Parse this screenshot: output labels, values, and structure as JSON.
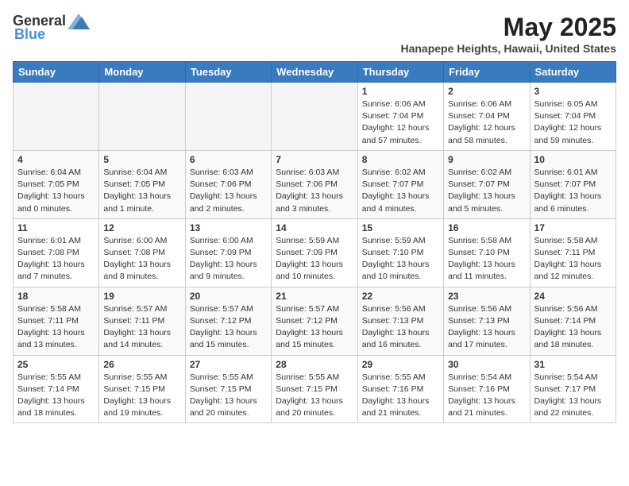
{
  "header": {
    "logo_general": "General",
    "logo_blue": "Blue",
    "month": "May 2025",
    "location": "Hanapepe Heights, Hawaii, United States"
  },
  "weekdays": [
    "Sunday",
    "Monday",
    "Tuesday",
    "Wednesday",
    "Thursday",
    "Friday",
    "Saturday"
  ],
  "weeks": [
    [
      {
        "day": "",
        "empty": true
      },
      {
        "day": "",
        "empty": true
      },
      {
        "day": "",
        "empty": true
      },
      {
        "day": "",
        "empty": true
      },
      {
        "day": "1",
        "sunrise": "Sunrise: 6:06 AM",
        "sunset": "Sunset: 7:04 PM",
        "daylight": "Daylight: 12 hours and 57 minutes."
      },
      {
        "day": "2",
        "sunrise": "Sunrise: 6:06 AM",
        "sunset": "Sunset: 7:04 PM",
        "daylight": "Daylight: 12 hours and 58 minutes."
      },
      {
        "day": "3",
        "sunrise": "Sunrise: 6:05 AM",
        "sunset": "Sunset: 7:04 PM",
        "daylight": "Daylight: 12 hours and 59 minutes."
      }
    ],
    [
      {
        "day": "4",
        "sunrise": "Sunrise: 6:04 AM",
        "sunset": "Sunset: 7:05 PM",
        "daylight": "Daylight: 13 hours and 0 minutes."
      },
      {
        "day": "5",
        "sunrise": "Sunrise: 6:04 AM",
        "sunset": "Sunset: 7:05 PM",
        "daylight": "Daylight: 13 hours and 1 minute."
      },
      {
        "day": "6",
        "sunrise": "Sunrise: 6:03 AM",
        "sunset": "Sunset: 7:06 PM",
        "daylight": "Daylight: 13 hours and 2 minutes."
      },
      {
        "day": "7",
        "sunrise": "Sunrise: 6:03 AM",
        "sunset": "Sunset: 7:06 PM",
        "daylight": "Daylight: 13 hours and 3 minutes."
      },
      {
        "day": "8",
        "sunrise": "Sunrise: 6:02 AM",
        "sunset": "Sunset: 7:07 PM",
        "daylight": "Daylight: 13 hours and 4 minutes."
      },
      {
        "day": "9",
        "sunrise": "Sunrise: 6:02 AM",
        "sunset": "Sunset: 7:07 PM",
        "daylight": "Daylight: 13 hours and 5 minutes."
      },
      {
        "day": "10",
        "sunrise": "Sunrise: 6:01 AM",
        "sunset": "Sunset: 7:07 PM",
        "daylight": "Daylight: 13 hours and 6 minutes."
      }
    ],
    [
      {
        "day": "11",
        "sunrise": "Sunrise: 6:01 AM",
        "sunset": "Sunset: 7:08 PM",
        "daylight": "Daylight: 13 hours and 7 minutes."
      },
      {
        "day": "12",
        "sunrise": "Sunrise: 6:00 AM",
        "sunset": "Sunset: 7:08 PM",
        "daylight": "Daylight: 13 hours and 8 minutes."
      },
      {
        "day": "13",
        "sunrise": "Sunrise: 6:00 AM",
        "sunset": "Sunset: 7:09 PM",
        "daylight": "Daylight: 13 hours and 9 minutes."
      },
      {
        "day": "14",
        "sunrise": "Sunrise: 5:59 AM",
        "sunset": "Sunset: 7:09 PM",
        "daylight": "Daylight: 13 hours and 10 minutes."
      },
      {
        "day": "15",
        "sunrise": "Sunrise: 5:59 AM",
        "sunset": "Sunset: 7:10 PM",
        "daylight": "Daylight: 13 hours and 10 minutes."
      },
      {
        "day": "16",
        "sunrise": "Sunrise: 5:58 AM",
        "sunset": "Sunset: 7:10 PM",
        "daylight": "Daylight: 13 hours and 11 minutes."
      },
      {
        "day": "17",
        "sunrise": "Sunrise: 5:58 AM",
        "sunset": "Sunset: 7:11 PM",
        "daylight": "Daylight: 13 hours and 12 minutes."
      }
    ],
    [
      {
        "day": "18",
        "sunrise": "Sunrise: 5:58 AM",
        "sunset": "Sunset: 7:11 PM",
        "daylight": "Daylight: 13 hours and 13 minutes."
      },
      {
        "day": "19",
        "sunrise": "Sunrise: 5:57 AM",
        "sunset": "Sunset: 7:11 PM",
        "daylight": "Daylight: 13 hours and 14 minutes."
      },
      {
        "day": "20",
        "sunrise": "Sunrise: 5:57 AM",
        "sunset": "Sunset: 7:12 PM",
        "daylight": "Daylight: 13 hours and 15 minutes."
      },
      {
        "day": "21",
        "sunrise": "Sunrise: 5:57 AM",
        "sunset": "Sunset: 7:12 PM",
        "daylight": "Daylight: 13 hours and 15 minutes."
      },
      {
        "day": "22",
        "sunrise": "Sunrise: 5:56 AM",
        "sunset": "Sunset: 7:13 PM",
        "daylight": "Daylight: 13 hours and 16 minutes."
      },
      {
        "day": "23",
        "sunrise": "Sunrise: 5:56 AM",
        "sunset": "Sunset: 7:13 PM",
        "daylight": "Daylight: 13 hours and 17 minutes."
      },
      {
        "day": "24",
        "sunrise": "Sunrise: 5:56 AM",
        "sunset": "Sunset: 7:14 PM",
        "daylight": "Daylight: 13 hours and 18 minutes."
      }
    ],
    [
      {
        "day": "25",
        "sunrise": "Sunrise: 5:55 AM",
        "sunset": "Sunset: 7:14 PM",
        "daylight": "Daylight: 13 hours and 18 minutes."
      },
      {
        "day": "26",
        "sunrise": "Sunrise: 5:55 AM",
        "sunset": "Sunset: 7:15 PM",
        "daylight": "Daylight: 13 hours and 19 minutes."
      },
      {
        "day": "27",
        "sunrise": "Sunrise: 5:55 AM",
        "sunset": "Sunset: 7:15 PM",
        "daylight": "Daylight: 13 hours and 20 minutes."
      },
      {
        "day": "28",
        "sunrise": "Sunrise: 5:55 AM",
        "sunset": "Sunset: 7:15 PM",
        "daylight": "Daylight: 13 hours and 20 minutes."
      },
      {
        "day": "29",
        "sunrise": "Sunrise: 5:55 AM",
        "sunset": "Sunset: 7:16 PM",
        "daylight": "Daylight: 13 hours and 21 minutes."
      },
      {
        "day": "30",
        "sunrise": "Sunrise: 5:54 AM",
        "sunset": "Sunset: 7:16 PM",
        "daylight": "Daylight: 13 hours and 21 minutes."
      },
      {
        "day": "31",
        "sunrise": "Sunrise: 5:54 AM",
        "sunset": "Sunset: 7:17 PM",
        "daylight": "Daylight: 13 hours and 22 minutes."
      }
    ]
  ]
}
